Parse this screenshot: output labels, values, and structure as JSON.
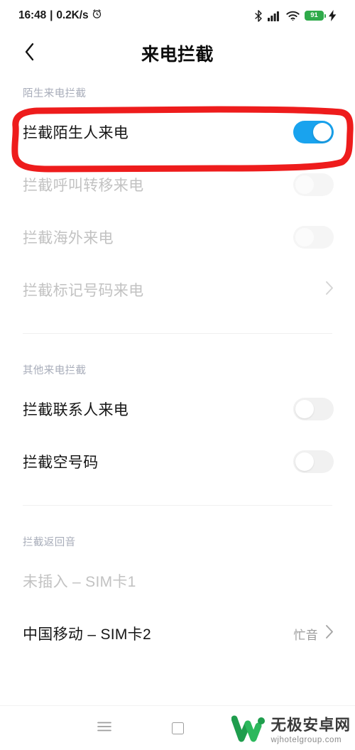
{
  "statusbar": {
    "time": "16:48",
    "separator": "|",
    "netspeed": "0.2K/s",
    "alarm_icon": "alarm-clock-icon",
    "bluetooth_icon": "bluetooth-icon",
    "signal_icon": "cellular-signal-icon",
    "wifi_icon": "wifi-icon",
    "battery_level": "91",
    "battery_color": "#2faa4a",
    "charging_icon": "charging-bolt-icon"
  },
  "titlebar": {
    "back_icon": "chevron-left-icon",
    "title": "来电拦截"
  },
  "sections": [
    {
      "header": "陌生来电拦截",
      "rows": [
        {
          "label": "拦截陌生人来电",
          "control": "toggle",
          "state": "on",
          "disabled": false,
          "highlighted": true
        },
        {
          "label": "拦截呼叫转移来电",
          "control": "toggle",
          "state": "off",
          "disabled": true
        },
        {
          "label": "拦截海外来电",
          "control": "toggle",
          "state": "off",
          "disabled": true
        },
        {
          "label": "拦截标记号码来电",
          "control": "chevron",
          "disabled": true
        }
      ]
    },
    {
      "header": "其他来电拦截",
      "rows": [
        {
          "label": "拦截联系人来电",
          "control": "toggle",
          "state": "off",
          "disabled": false
        },
        {
          "label": "拦截空号码",
          "control": "toggle",
          "state": "off",
          "disabled": false
        }
      ]
    },
    {
      "header": "拦截返回音",
      "rows": [
        {
          "label": "未插入 – SIM卡1",
          "control": "none",
          "disabled": true
        },
        {
          "label": "中国移动 – SIM卡2",
          "control": "chevron",
          "value": "忙音",
          "disabled": false
        }
      ]
    }
  ],
  "annotation": {
    "shape": "red-highlight-rectangle",
    "color": "#ee1c1c",
    "targets": "拦截陌生人来电"
  },
  "navbar": {
    "menu_icon": "hamburger-menu-icon",
    "home_icon": "square-home-icon"
  },
  "watermark": {
    "logo_icon": "w-logo-icon",
    "logo_color": "#16a34a",
    "name": "无极安卓网",
    "url": "wjhotelgroup.com"
  },
  "colors": {
    "toggle_on": "#19a3ee",
    "toggle_off": "#f1f1f1",
    "section_header": "#a8adba",
    "disabled_text": "#c2c2c2",
    "annotation_red": "#ee1c1c"
  }
}
